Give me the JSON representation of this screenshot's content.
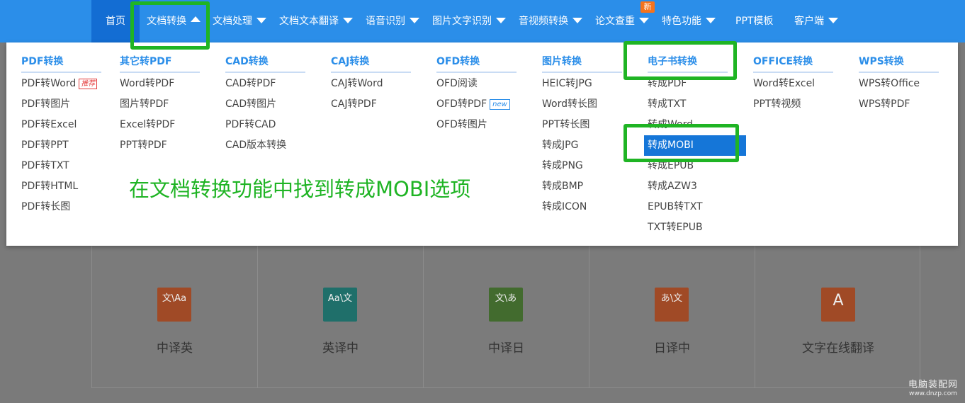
{
  "nav": {
    "items": [
      {
        "label": "首页"
      },
      {
        "label": "文档转换"
      },
      {
        "label": "文档处理"
      },
      {
        "label": "文档文本翻译"
      },
      {
        "label": "语音识别"
      },
      {
        "label": "图片文字识别"
      },
      {
        "label": "音视频转换"
      },
      {
        "label": "论文查重"
      },
      {
        "label": "特色功能"
      },
      {
        "label": "PPT模板"
      },
      {
        "label": "客户端"
      }
    ],
    "new_badge": "新"
  },
  "dropdown": {
    "columns": [
      {
        "title": "PDF转换",
        "items": [
          "PDF转Word",
          "PDF转图片",
          "PDF转Excel",
          "PDF转PPT",
          "PDF转TXT",
          "PDF转HTML",
          "PDF转长图"
        ]
      },
      {
        "title": "其它转PDF",
        "items": [
          "Word转PDF",
          "图片转PDF",
          "Excel转PDF",
          "PPT转PDF"
        ]
      },
      {
        "title": "CAD转换",
        "items": [
          "CAD转PDF",
          "CAD转图片",
          "PDF转CAD",
          "CAD版本转换"
        ]
      },
      {
        "title": "CAJ转换",
        "items": [
          "CAJ转Word",
          "CAJ转PDF"
        ]
      },
      {
        "title": "OFD转换",
        "items": [
          "OFD阅读",
          "OFD转PDF",
          "OFD转图片"
        ]
      },
      {
        "title": "图片转换",
        "items": [
          "HEIC转JPG",
          "Word转长图",
          "PPT转长图",
          "转成JPG",
          "转成PNG",
          "转成BMP",
          "转成ICON"
        ]
      },
      {
        "title": "电子书转换",
        "items": [
          "转成PDF",
          "转成TXT",
          "转成Word",
          "转成MOBI",
          "转成EPUB",
          "转成AZW3",
          "EPUB转TXT",
          "TXT转EPUB"
        ]
      },
      {
        "title": "OFFICE转换",
        "items": [
          "Word转Excel",
          "PPT转视频"
        ]
      },
      {
        "title": "WPS转换",
        "items": [
          "WPS转Office",
          "WPS转PDF"
        ]
      }
    ],
    "tags": {
      "hot": "推荐",
      "new": "new"
    }
  },
  "annotation": "在文档转换功能中找到转成MOBI选项",
  "cards": [
    {
      "label": "中译英",
      "icon": "文\\Aa",
      "color": "#a04a26"
    },
    {
      "label": "英译中",
      "icon": "Aa\\文",
      "color": "#1f6f6a"
    },
    {
      "label": "中译日",
      "icon": "文\\あ",
      "color": "#426b2e"
    },
    {
      "label": "日译中",
      "icon": "あ\\文",
      "color": "#a04a26"
    },
    {
      "label": "文字在线翻译",
      "icon": "A",
      "color": "#a04a26"
    }
  ],
  "watermark": {
    "main": "电脑装配网",
    "sub": "www.dnzp.com"
  },
  "colors": {
    "nav": "#2b8ee9",
    "active_nav": "#136dd3",
    "highlight": "#1fb424",
    "active_item": "#1576d8"
  }
}
